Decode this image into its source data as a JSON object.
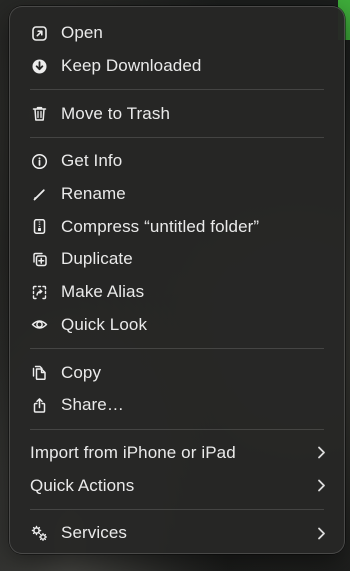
{
  "menu": {
    "groups": [
      {
        "items": [
          {
            "label": "Open",
            "icon": "open-arrow-icon",
            "name": "menu-item-open"
          },
          {
            "label": "Keep Downloaded",
            "icon": "download-circle-icon",
            "name": "menu-item-keep-downloaded"
          }
        ]
      },
      {
        "items": [
          {
            "label": "Move to Trash",
            "icon": "trash-icon",
            "name": "menu-item-move-to-trash"
          }
        ]
      },
      {
        "items": [
          {
            "label": "Get Info",
            "icon": "info-circle-icon",
            "name": "menu-item-get-info"
          },
          {
            "label": "Rename",
            "icon": "pencil-icon",
            "name": "menu-item-rename"
          },
          {
            "label": "Compress “untitled folder”",
            "icon": "archive-zip-icon",
            "name": "menu-item-compress"
          },
          {
            "label": "Duplicate",
            "icon": "duplicate-plus-icon",
            "name": "menu-item-duplicate"
          },
          {
            "label": "Make Alias",
            "icon": "alias-arrow-icon",
            "name": "menu-item-make-alias"
          },
          {
            "label": "Quick Look",
            "icon": "eye-icon",
            "name": "menu-item-quick-look"
          }
        ]
      },
      {
        "items": [
          {
            "label": "Copy",
            "icon": "copy-doc-icon",
            "name": "menu-item-copy"
          },
          {
            "label": "Share…",
            "icon": "share-icon",
            "name": "menu-item-share"
          }
        ]
      },
      {
        "items": [
          {
            "label": "Import from iPhone or iPad",
            "submenu": true,
            "name": "menu-item-import-from-iphone"
          },
          {
            "label": "Quick Actions",
            "submenu": true,
            "name": "menu-item-quick-actions"
          }
        ]
      },
      {
        "items": [
          {
            "label": "Services",
            "icon": "gears-icon",
            "submenu": true,
            "name": "menu-item-services"
          }
        ]
      }
    ]
  },
  "colors": {
    "menu_bg": "#262625",
    "text": "#eaeaea",
    "separator": "#3b3b3a",
    "accent_edge": "#3fae3b"
  }
}
